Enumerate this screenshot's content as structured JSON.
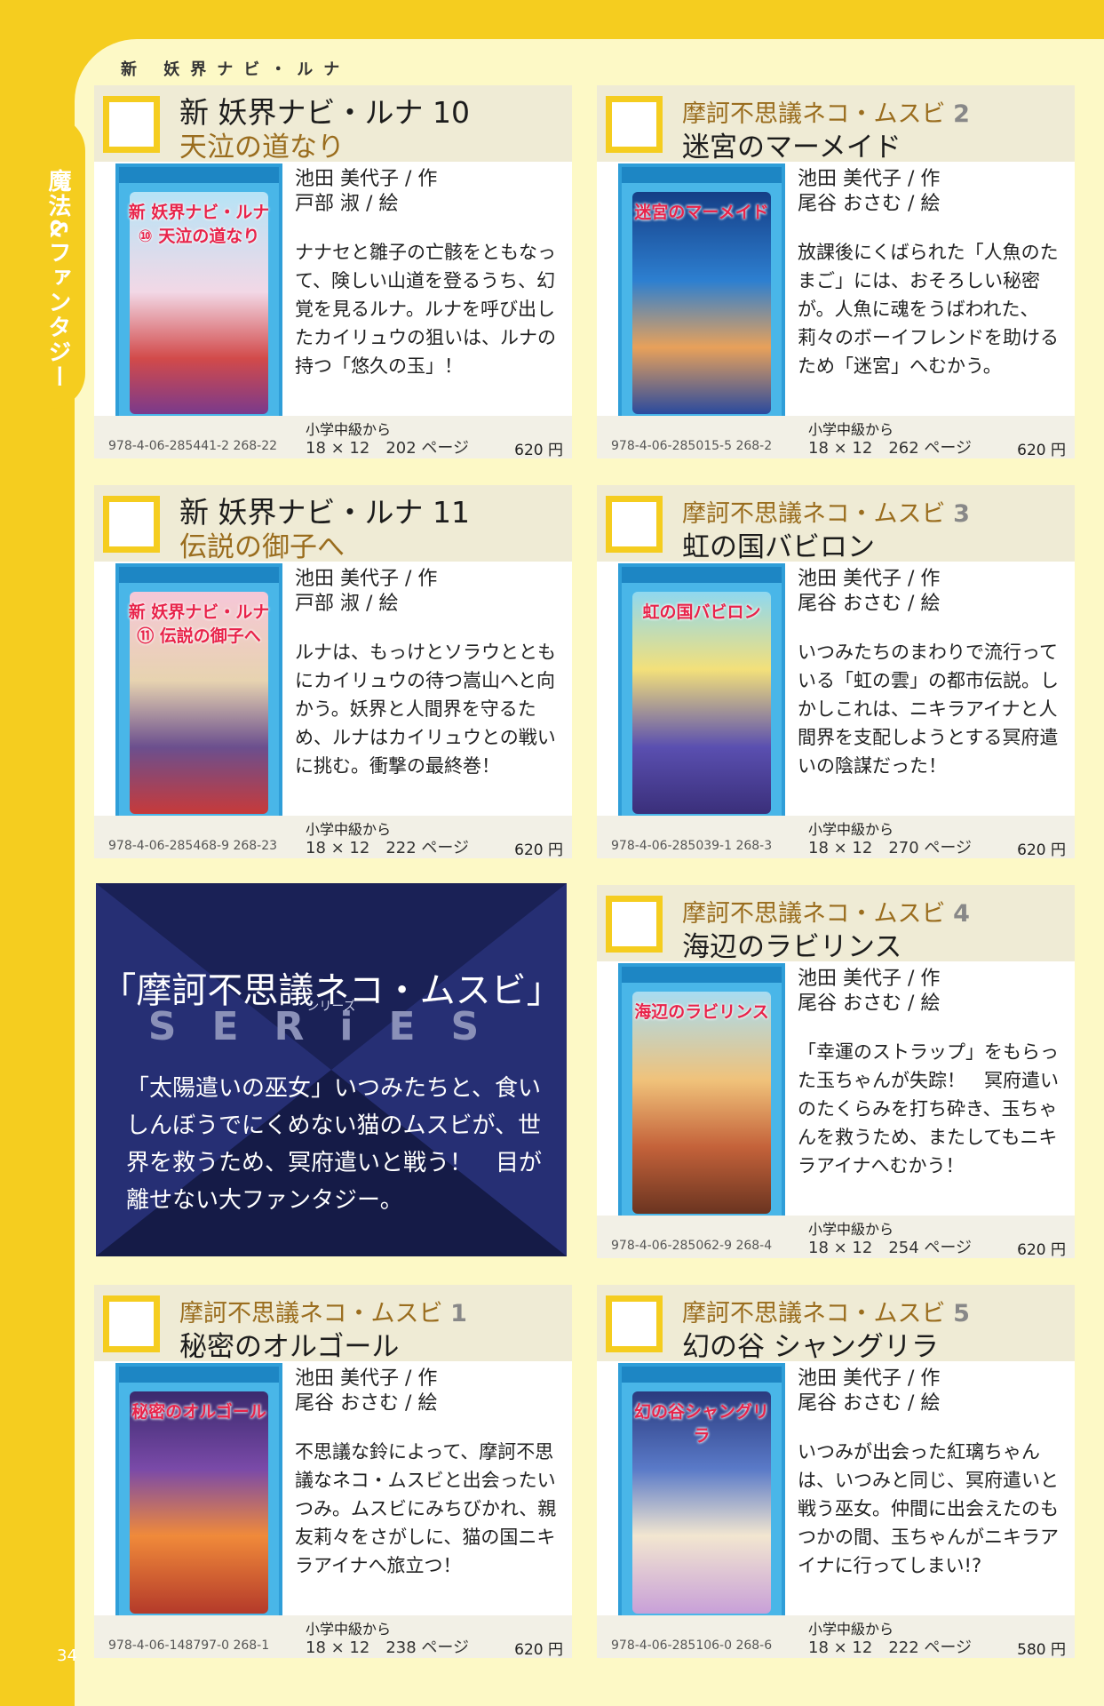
{
  "page": {
    "side_label": "魔法&ファンタジー",
    "page_number": "34",
    "series_heading": "新 妖界ナビ・ルナ"
  },
  "promo": {
    "title": "「摩訶不思議ネコ・ムスビ」",
    "series_word": "SERiES",
    "series_ruby": "シリーズ",
    "text": "「太陽遣いの巫女」いつみたちと、食いしんぼうでにくめない猫のムスビが、世界を救うため、冥府遣いと戦う！　目が離せない大ファンタジー。"
  },
  "books": [
    {
      "series": "新 妖界ナビ・ルナ 10",
      "title": "天泣の道なり",
      "author": "池田 美代子 / 作",
      "illustrator": "戸部 淑 / 絵",
      "description": "ナナセと雛子の亡骸をともなって、険しい山道を登るうち、幻覚を見るルナ。ルナを呼び出したカイリュウの狙いは、ルナの持つ「悠久の玉」！",
      "grade": "小学中級から",
      "isbn": "978-4-06-285441-2 268-22",
      "size": "18 × 12　202 ページ",
      "price": "620 円",
      "cover_text": "新 妖界ナビ・ルナ⑩ 天泣の道なり"
    },
    {
      "series": "摩訶不思議ネコ・ムスビ",
      "series_num": "2",
      "title": "迷宮のマーメイド",
      "author": "池田 美代子 / 作",
      "illustrator": "尾谷 おさむ / 絵",
      "description": "放課後にくばられた「人魚のたまご」には、おそろしい秘密が。人魚に魂をうばわれた、莉々のボーイフレンドを助けるため「迷宮」へむかう。",
      "grade": "小学中級から",
      "isbn": "978-4-06-285015-5 268-2",
      "size": "18 × 12　262 ページ",
      "price": "620 円",
      "cover_text": "迷宮のマーメイド"
    },
    {
      "series": "新 妖界ナビ・ルナ 11",
      "title": "伝説の御子へ",
      "author": "池田 美代子 / 作",
      "illustrator": "戸部 淑 / 絵",
      "description": "ルナは、もっけとソラウとともにカイリュウの待つ嵩山へと向かう。妖界と人間界を守るため、ルナはカイリュウとの戦いに挑む。衝撃の最終巻！",
      "grade": "小学中級から",
      "isbn": "978-4-06-285468-9 268-23",
      "size": "18 × 12　222 ページ",
      "price": "620 円",
      "cover_text": "新 妖界ナビ・ルナ⑪ 伝説の御子へ"
    },
    {
      "series": "摩訶不思議ネコ・ムスビ",
      "series_num": "3",
      "title": "虹の国バビロン",
      "author": "池田 美代子 / 作",
      "illustrator": "尾谷 おさむ / 絵",
      "description": "いつみたちのまわりで流行っている「虹の雲」の都市伝説。しかしこれは、ニキラアイナと人間界を支配しようとする冥府遣いの陰謀だった！",
      "grade": "小学中級から",
      "isbn": "978-4-06-285039-1 268-3",
      "size": "18 × 12　270 ページ",
      "price": "620 円",
      "cover_text": "虹の国バビロン"
    },
    {
      "series": "摩訶不思議ネコ・ムスビ",
      "series_num": "4",
      "title": "海辺のラビリンス",
      "author": "池田 美代子 / 作",
      "illustrator": "尾谷 おさむ / 絵",
      "description": "「幸運のストラップ」をもらった玉ちゃんが失踪！　冥府遣いのたくらみを打ち砕き、玉ちゃんを救うため、またしてもニキラアイナへむかう！",
      "grade": "小学中級から",
      "isbn": "978-4-06-285062-9 268-4",
      "size": "18 × 12　254 ページ",
      "price": "620 円",
      "cover_text": "海辺のラビリンス"
    },
    {
      "series": "摩訶不思議ネコ・ムスビ",
      "series_num": "1",
      "title": "秘密のオルゴール",
      "author": "池田 美代子 / 作",
      "illustrator": "尾谷 おさむ / 絵",
      "description": "不思議な鈴によって、摩訶不思議なネコ・ムスビと出会ったいつみ。ムスビにみちびかれ、親友莉々をさがしに、猫の国ニキラアイナへ旅立つ！",
      "grade": "小学中級から",
      "isbn": "978-4-06-148797-0 268-1",
      "size": "18 × 12　238 ページ",
      "price": "620 円",
      "cover_text": "秘密のオルゴール"
    },
    {
      "series": "摩訶不思議ネコ・ムスビ",
      "series_num": "5",
      "title": "幻の谷 シャングリラ",
      "author": "池田 美代子 / 作",
      "illustrator": "尾谷 おさむ / 絵",
      "description": "いつみが出会った紅璃ちゃんは、いつみと同じ、冥府遣いと戦う巫女。仲間に出会えたのもつかの間、玉ちゃんがニキラアイナに行ってしまい!?",
      "grade": "小学中級から",
      "isbn": "978-4-06-285106-0 268-6",
      "size": "18 × 12　222 ページ",
      "price": "580 円",
      "cover_text": "幻の谷シャングリラ"
    }
  ],
  "colors": {
    "page_yellow": "#f5cd1f",
    "panel_cream": "#fdf9c6",
    "series_brown": "#9a6d1e",
    "promo_navy": "#1d2560"
  }
}
